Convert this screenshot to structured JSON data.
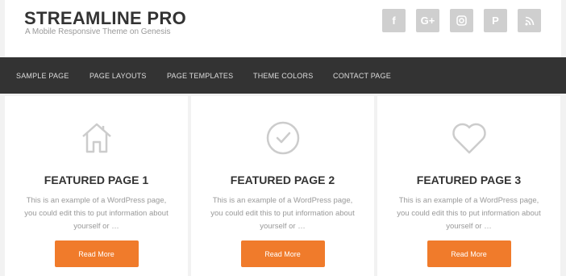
{
  "header": {
    "title": "STREAMLINE PRO",
    "description": "A Mobile Responsive Theme on Genesis"
  },
  "social": [
    {
      "icon": "facebook-icon",
      "glyph": "f"
    },
    {
      "icon": "google-plus-icon",
      "glyph": "G+"
    },
    {
      "icon": "instagram-icon",
      "glyph": "◎"
    },
    {
      "icon": "pinterest-icon",
      "glyph": "P"
    },
    {
      "icon": "rss-icon",
      "glyph": "◠"
    }
  ],
  "nav": {
    "items": [
      "SAMPLE PAGE",
      "PAGE LAYOUTS",
      "PAGE TEMPLATES",
      "THEME COLORS",
      "CONTACT PAGE"
    ]
  },
  "cards": [
    {
      "icon": "home-icon",
      "title": "FEATURED PAGE 1",
      "text": "This is an example of a WordPress page, you could edit this to put information about yourself or …",
      "button": "Read More"
    },
    {
      "icon": "check-circle-icon",
      "title": "FEATURED PAGE 2",
      "text": "This is an example of a WordPress page, you could edit this to put information about yourself or …",
      "button": "Read More"
    },
    {
      "icon": "heart-icon",
      "title": "FEATURED PAGE 3",
      "text": "This is an example of a WordPress page, you could edit this to put information about yourself or …",
      "button": "Read More"
    }
  ],
  "colors": {
    "accent": "#f07b2b",
    "nav_bg": "#333333",
    "icon_gray": "#cccccc"
  }
}
